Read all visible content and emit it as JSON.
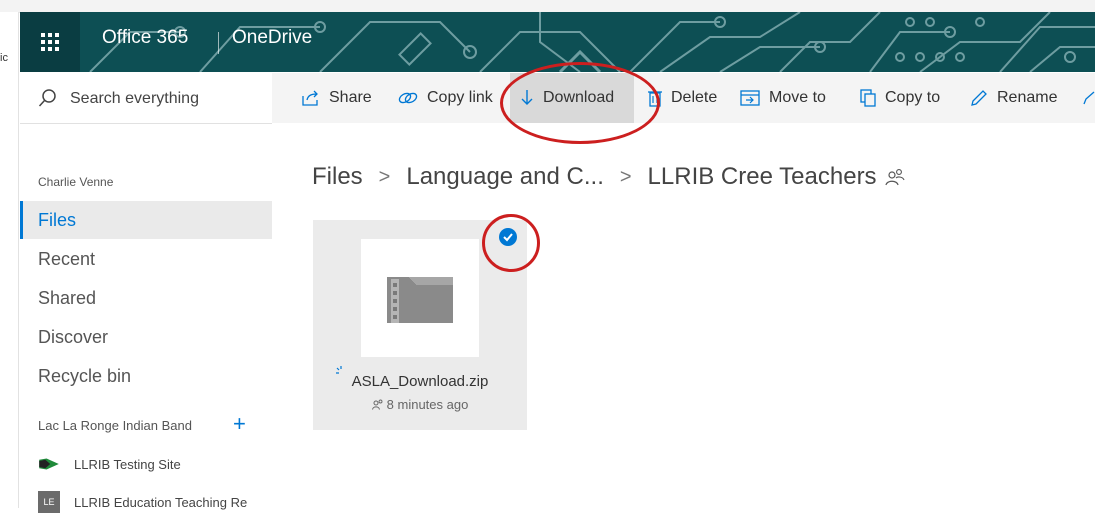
{
  "header": {
    "brand": "Office 365",
    "app": "OneDrive",
    "left_fragment": "ic"
  },
  "search": {
    "label": "Search everything"
  },
  "commands": {
    "share": "Share",
    "copy_link": "Copy link",
    "download": "Download",
    "delete": "Delete",
    "move_to": "Move to",
    "copy_to": "Copy to",
    "rename": "Rename"
  },
  "sidebar": {
    "owner": "Charlie Venne",
    "items": [
      {
        "label": "Files"
      },
      {
        "label": "Recent"
      },
      {
        "label": "Shared"
      },
      {
        "label": "Discover"
      },
      {
        "label": "Recycle bin"
      }
    ],
    "group_title": "Lac La Ronge Indian Band",
    "group_add": "+",
    "sites": [
      {
        "label": "LLRIB Testing Site"
      },
      {
        "label": "LLRIB Education Teaching Re",
        "abbr": "LE"
      }
    ]
  },
  "breadcrumb": {
    "items": [
      "Files",
      "Language and C...",
      "LLRIB Cree Teachers"
    ],
    "separator": ">"
  },
  "file": {
    "name": "ASLA_Download.zip",
    "modified": "8 minutes ago",
    "selected": true
  },
  "colors": {
    "accent": "#0078d4",
    "suite_bar": "#0d4f54",
    "annotation": "#cc1f1f"
  }
}
